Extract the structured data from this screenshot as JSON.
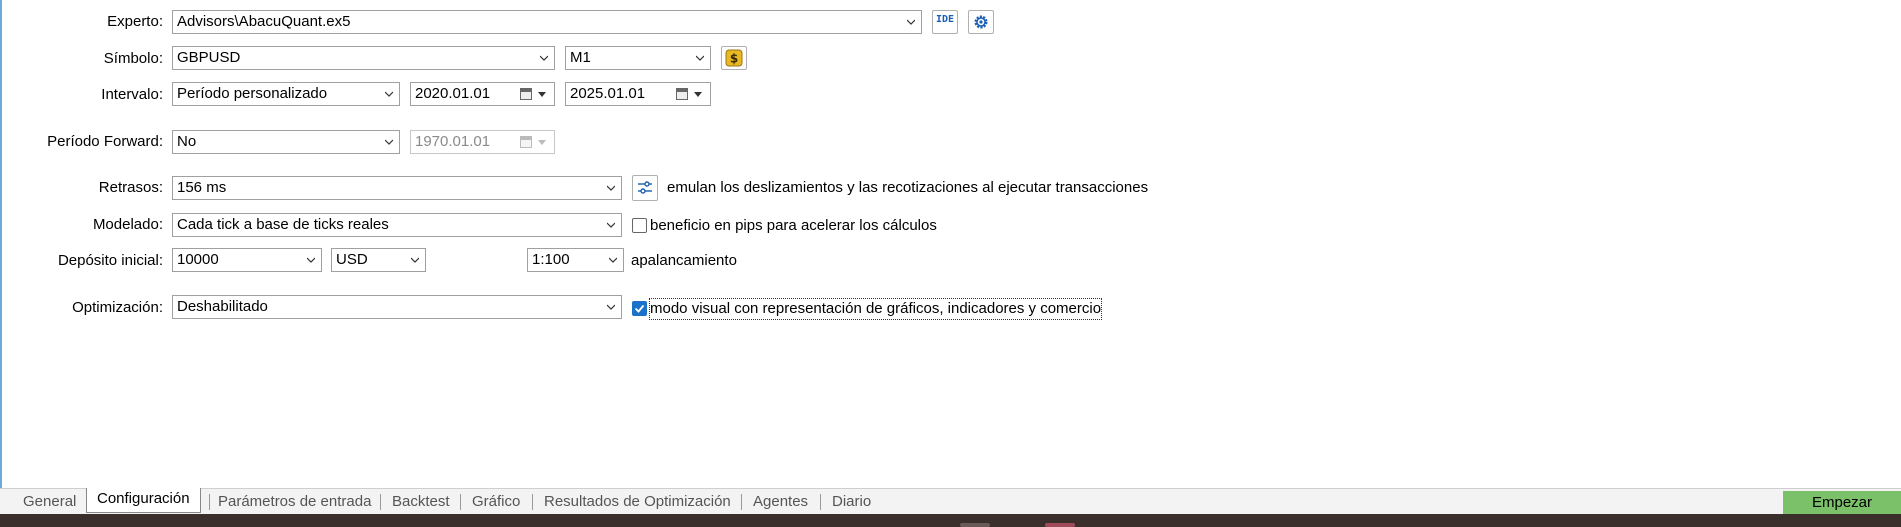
{
  "form": {
    "expert": {
      "label": "Experto:",
      "value": "Advisors\\AbacuQuant.ex5",
      "ide_label": "IDE"
    },
    "symbol": {
      "label": "Símbolo:",
      "value": "GBPUSD",
      "timeframe": "M1"
    },
    "interval": {
      "label": "Intervalo:",
      "value": "Período personalizado",
      "from": "2020.01.01",
      "to": "2025.01.01"
    },
    "forward": {
      "label": "Período Forward:",
      "value": "No",
      "date": "1970.01.01"
    },
    "delays": {
      "label": "Retrasos:",
      "value": "156 ms",
      "note": "emulan los deslizamientos y las recotizaciones al ejecutar transacciones"
    },
    "modeling": {
      "label": "Modelado:",
      "value": "Cada tick a base de ticks reales",
      "pips_label": "beneficio en pips para acelerar los cálculos",
      "pips_checked": false
    },
    "deposit": {
      "label": "Depósito inicial:",
      "value": "10000",
      "currency": "USD",
      "leverage": "1:100",
      "leverage_label": "apalancamiento"
    },
    "optimization": {
      "label": "Optimización:",
      "value": "Deshabilitado",
      "visual_label": "modo visual con representación de gráficos, indicadores y comercio",
      "visual_checked": true
    }
  },
  "tabs": [
    {
      "label": "General"
    },
    {
      "label": "Configuración",
      "active": true
    },
    {
      "label": "Parámetros de entrada"
    },
    {
      "label": "Backtest"
    },
    {
      "label": "Gráfico"
    },
    {
      "label": "Resultados de Optimización"
    },
    {
      "label": "Agentes"
    },
    {
      "label": "Diario"
    }
  ],
  "start_button": "Empezar",
  "colors": {
    "accent": "#1a73c8",
    "start": "#7ac169",
    "coin": "#e8b923"
  }
}
